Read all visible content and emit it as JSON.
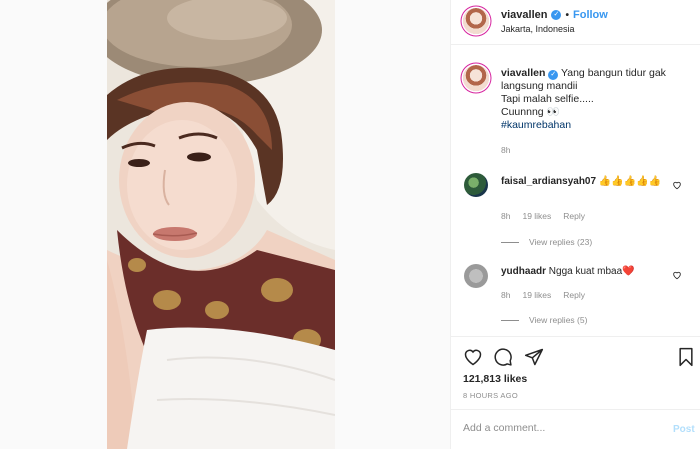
{
  "header": {
    "username": "viavallen",
    "separator": "•",
    "follow_label": "Follow",
    "location": "Jakarta, Indonesia"
  },
  "caption": {
    "username": "viavallen",
    "lines": [
      "Yang bangun tidur gak langsung mandii",
      "Tapi malah selfie.....",
      "Cuunnng 👀"
    ],
    "hashtag": "#kaumrebahan",
    "time": "8h"
  },
  "comments": [
    {
      "username": "faisal_ardiansyah07",
      "text": "👍👍👍👍👍",
      "time": "8h",
      "likes": "19 likes",
      "reply_label": "Reply",
      "view_replies": "View replies (23)"
    },
    {
      "username": "yudhaadr",
      "text": "Ngga kuat mbaa❤️",
      "time": "8h",
      "likes": "19 likes",
      "reply_label": "Reply",
      "view_replies": "View replies (5)"
    }
  ],
  "stats": {
    "likes": "121,813 likes",
    "time_ago": "8 HOURS AGO"
  },
  "add_comment": {
    "placeholder": "Add a comment...",
    "post_label": "Post"
  },
  "colors": {
    "accent": "#3897f0",
    "post_disabled": "#b2dffc",
    "hashtag": "#003569"
  }
}
